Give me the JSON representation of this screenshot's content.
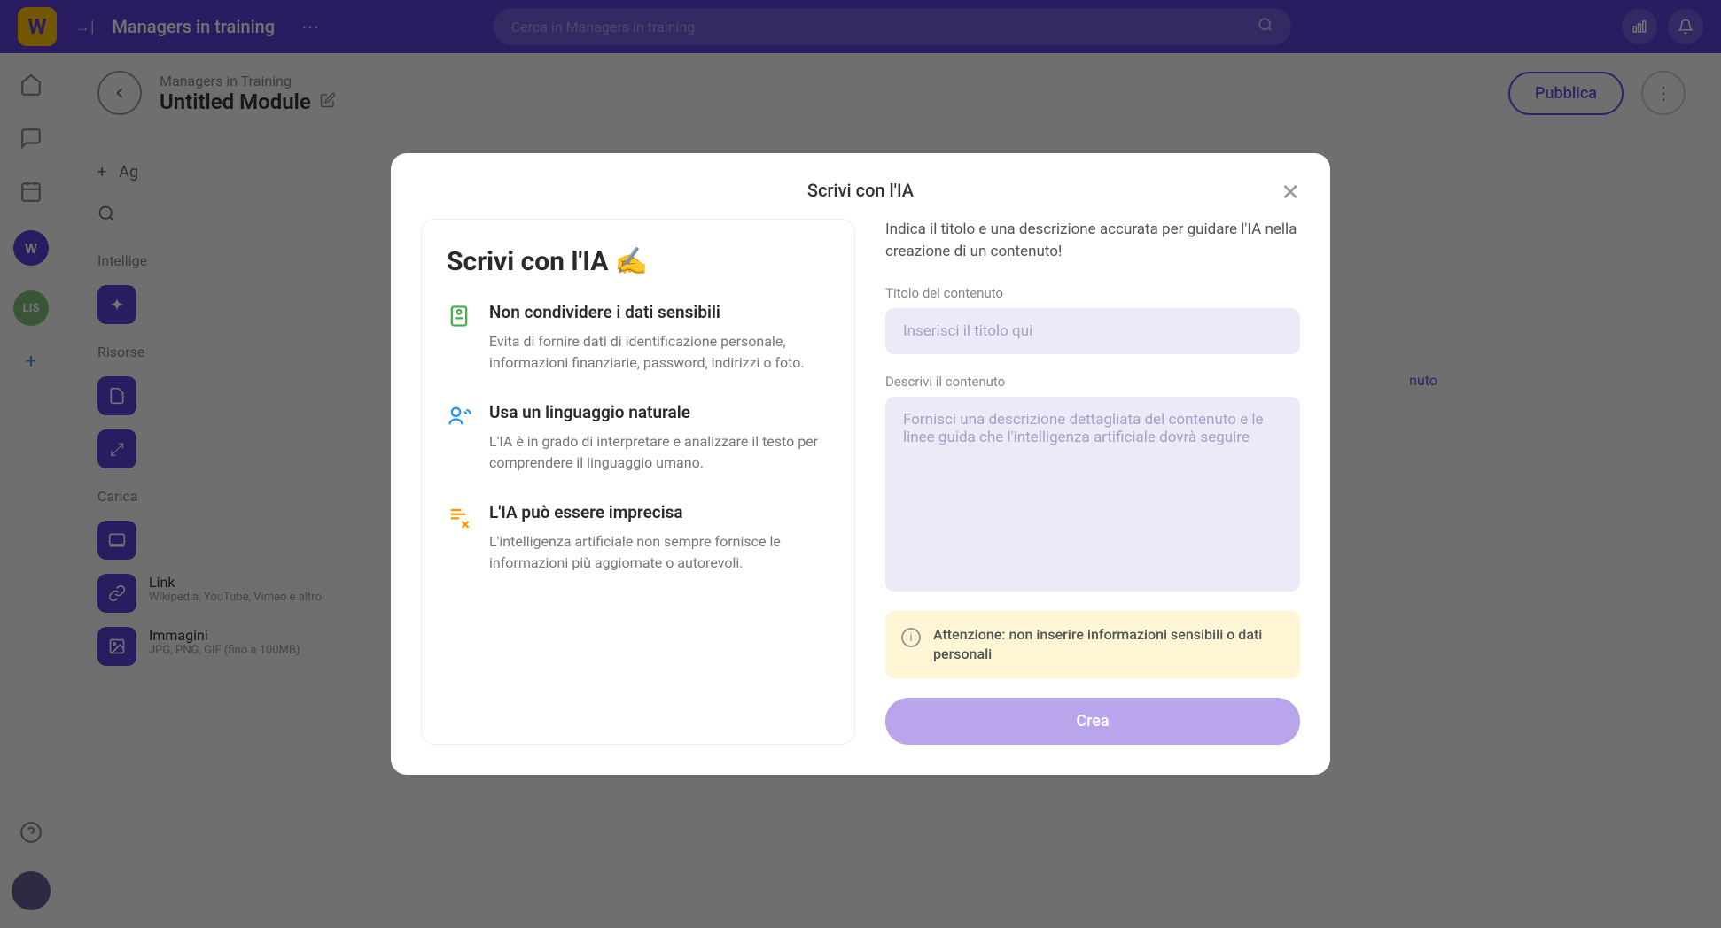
{
  "header": {
    "logo_letter": "W",
    "title": "Managers in training",
    "search_placeholder": "Cerca in Managers in training"
  },
  "page": {
    "breadcrumb": "Managers in Training",
    "module_title": "Untitled Module",
    "publish_label": "Pubblica"
  },
  "palette": {
    "add_label": "Ag",
    "section_ai": "Intellige",
    "section_risorse": "Risorse",
    "section_carica": "Carica",
    "link_title": "Link",
    "link_sub": "Wikipedia, YouTube, Vimeo e altro",
    "images_title": "Immagini",
    "images_sub": "JPG, PNG, GIF (fino a 100MB)"
  },
  "right_hint": "nuto",
  "rail": {
    "avatar_green_text": "LIS"
  },
  "modal": {
    "title": "Scrivi con l'IA",
    "left_heading": "Scrivi con l'IA  ✍️",
    "guidelines": [
      {
        "title": "Non condividere i dati sensibili",
        "desc": "Evita di fornire dati di identificazione personale, informazioni finanziarie, password, indirizzi o foto."
      },
      {
        "title": "Usa un linguaggio naturale",
        "desc": "L'IA è in grado di interpretare e analizzare il testo per comprendere il linguaggio umano."
      },
      {
        "title": "L'IA può essere imprecisa",
        "desc": "L'intelligenza artificiale non sempre fornisce le informazioni più aggiornate o autorevoli."
      }
    ],
    "right_intro": "Indica il titolo e una descrizione accurata per guidare l'IA nella creazione di un contenuto!",
    "title_field_label": "Titolo del contenuto",
    "title_placeholder": "Inserisci il titolo qui",
    "desc_field_label": "Descrivi il contenuto",
    "desc_placeholder": "Fornisci una descrizione dettagliata del contenuto e le linee guida che l'intelligenza artificiale dovrà seguire",
    "warning_text": "Attenzione: non inserire informazioni sensibili o dati personali",
    "create_label": "Crea"
  }
}
